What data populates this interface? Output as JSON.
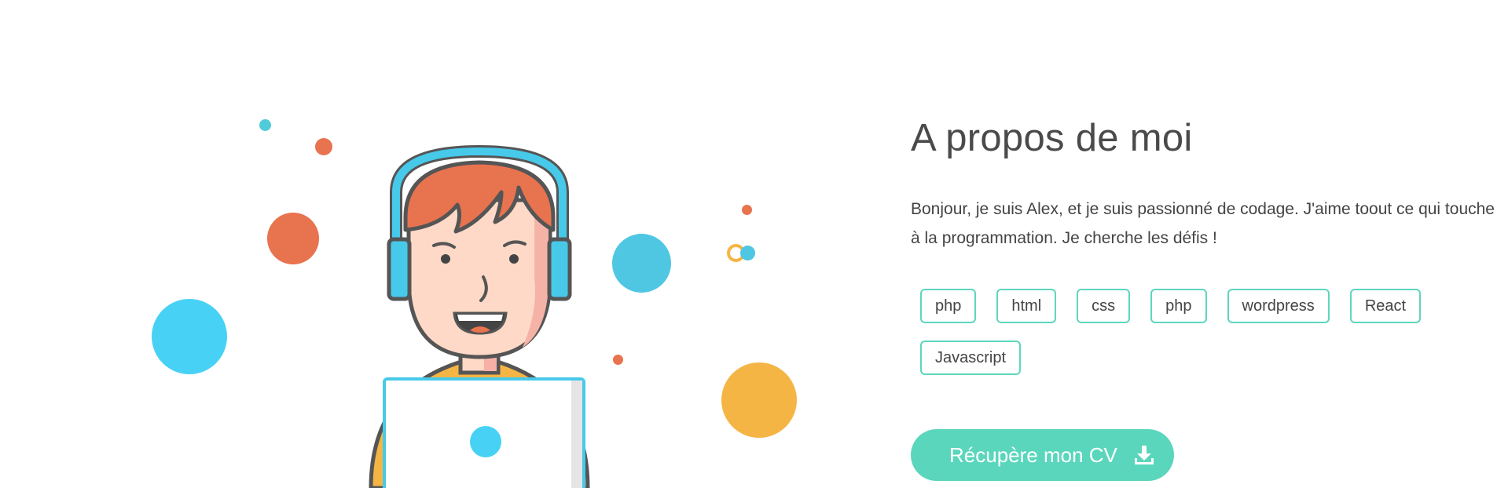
{
  "about": {
    "title": "A propos de moi",
    "text": "Bonjour, je suis Alex, et je suis passionné de codage. J'aime toout ce qui touche à la programmation. Je cherche les défis !",
    "tags": [
      "php",
      "html",
      "css",
      "php",
      "wordpress",
      "React",
      "Javascript"
    ],
    "cv_button": {
      "label": "Récupère mon CV",
      "icon": "download-icon"
    }
  },
  "illustration": {
    "icons": [
      "avatar-headphones",
      "laptop"
    ]
  },
  "colors": {
    "accent": "#5ad6bc",
    "text": "#4a4a4a",
    "orange": "#e8734f",
    "blue": "#45cdf0",
    "yellow": "#f5b545"
  }
}
